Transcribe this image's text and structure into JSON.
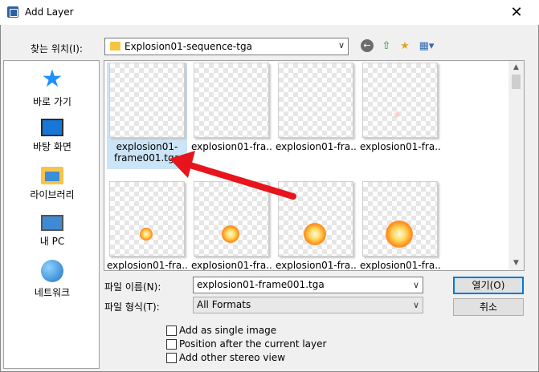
{
  "window": {
    "title": "Add Layer",
    "close_glyph": "✕"
  },
  "toolbar": {
    "lookin_label": "찾는 위치(I):",
    "lookin_value": "Explosion01-sequence-tga",
    "back_icon": "back-arrow-icon",
    "up_icon": "up-folder-icon",
    "newfolder_icon": "new-folder-icon",
    "views_icon": "view-menu-icon"
  },
  "places": [
    {
      "label": "바로 가기",
      "icon": "star-icon"
    },
    {
      "label": "바탕 화면",
      "icon": "desktop-icon"
    },
    {
      "label": "라이브러리",
      "icon": "library-icon"
    },
    {
      "label": "내 PC",
      "icon": "computer-icon"
    },
    {
      "label": "네트워크",
      "icon": "network-icon"
    }
  ],
  "files": [
    {
      "name": "explosion01-frame001.tga"
    },
    {
      "name": "explosion01-fra..."
    },
    {
      "name": "explosion01-fra..."
    },
    {
      "name": "explosion01-fra..."
    },
    {
      "name": "explosion01-fra..."
    },
    {
      "name": "explosion01-fra..."
    },
    {
      "name": "explosion01-fra..."
    },
    {
      "name": "explosion01-fra..."
    }
  ],
  "form": {
    "filename_label": "파일 이름(N):",
    "filename_value": "explosion01-frame001.tga",
    "filetype_label": "파일 형식(T):",
    "filetype_value": "All Formats",
    "open_button": "열기(O)",
    "cancel_button": "취소"
  },
  "options": [
    {
      "label": "Add as single image",
      "checked": false
    },
    {
      "label": "Position after the current layer",
      "checked": false
    },
    {
      "label": "Add other stereo view",
      "checked": false
    }
  ],
  "colors": {
    "annotation_arrow": "#e8141c",
    "selection": "#cce4f7",
    "default_button_border": "#0078d7"
  }
}
